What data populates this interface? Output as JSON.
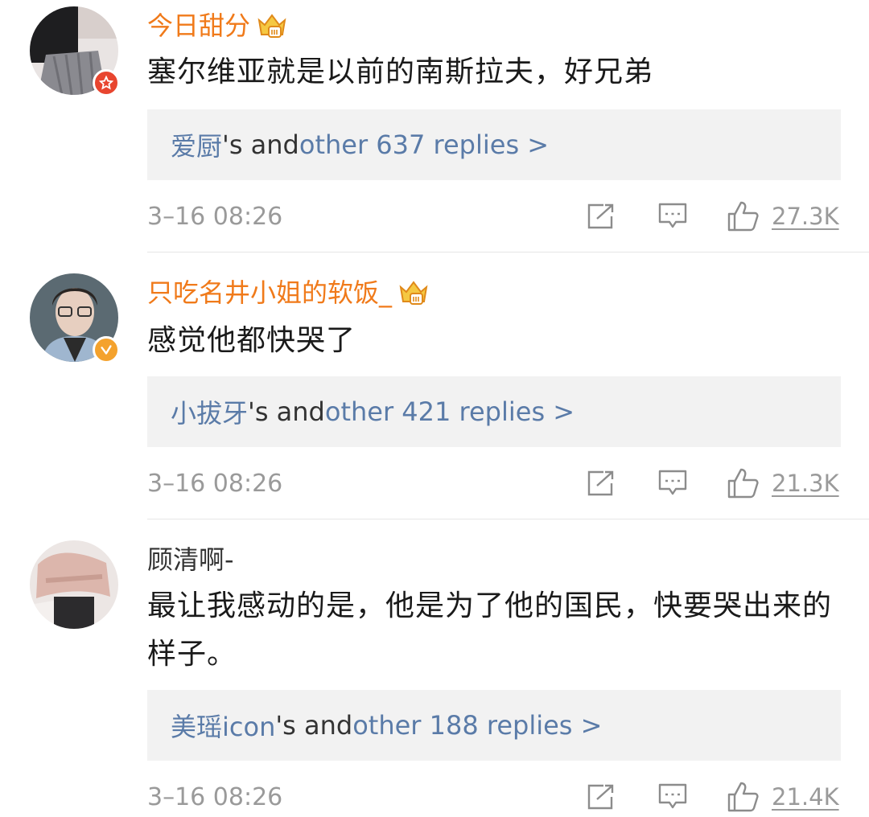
{
  "comments": [
    {
      "username": "今日甜分",
      "is_vip": true,
      "badge": "star-badge",
      "text": "塞尔维亚就是以前的南斯拉夫，好兄弟",
      "reply_name": "爱厨",
      "reply_mid": "'s and ",
      "reply_link": "other 637 replies >",
      "time": "3–16 08:26",
      "likes": "27.3K"
    },
    {
      "username": "只吃名井小姐的软饭_",
      "is_vip": true,
      "badge": "verified-badge",
      "text": "感觉他都快哭了",
      "reply_name": "小拔牙",
      "reply_mid": "'s and ",
      "reply_link": "other 421 replies >",
      "time": "3–16 08:26",
      "likes": "21.3K"
    },
    {
      "username": "顾清啊-",
      "is_vip": false,
      "badge": "",
      "text": "最让我感动的是，他是为了他的国民，快要哭出来的样子。",
      "reply_name": "美瑶icon",
      "reply_mid": "'s and ",
      "reply_link": "other 188 replies >",
      "time": "3–16 08:26",
      "likes": "21.4K"
    }
  ],
  "colors": {
    "vip_name": "#f07a1a",
    "link": "#5a7ba8",
    "meta": "#9a9a9a",
    "reply_bg": "#f2f2f2"
  },
  "icons": [
    "share-icon",
    "comment-icon",
    "like-icon",
    "crown-icon"
  ]
}
